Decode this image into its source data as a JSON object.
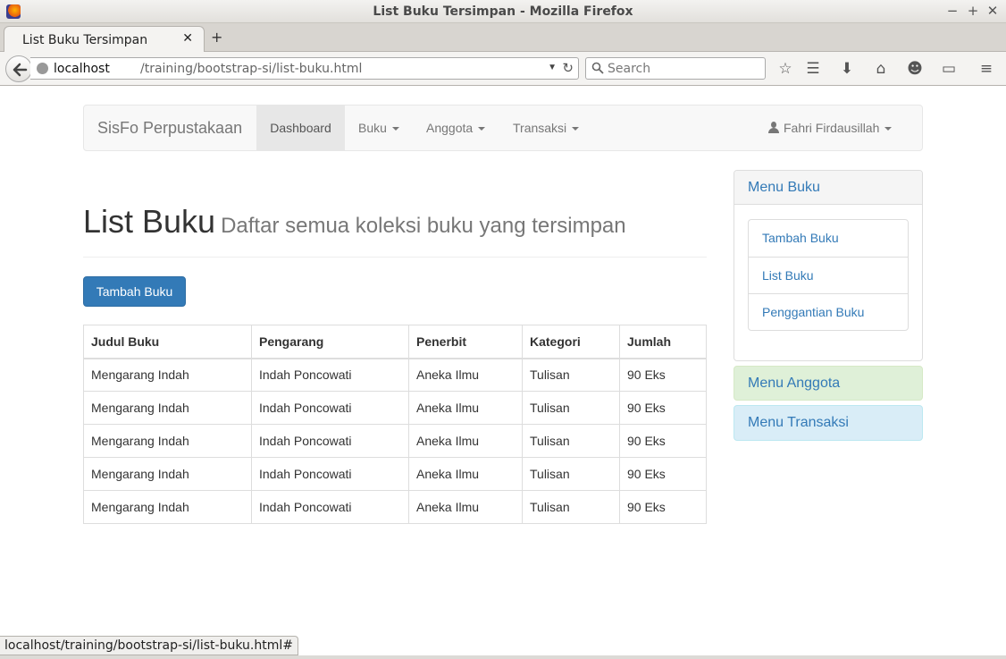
{
  "window": {
    "title": "List Buku Tersimpan - Mozilla Firefox",
    "tab_title": "List Buku Tersimpan",
    "url_host": "localhost",
    "url_path": "/training/bootstrap-si/list-buku.html",
    "search_placeholder": "Search",
    "status_url": "localhost/training/bootstrap-si/list-buku.html#"
  },
  "navbar": {
    "brand": "SisFo Perpustakaan",
    "items": [
      "Dashboard",
      "Buku",
      "Anggota",
      "Transaksi"
    ],
    "user": "Fahri Firdausillah"
  },
  "header": {
    "title": "List Buku",
    "subtitle": "Daftar semua koleksi buku yang tersimpan"
  },
  "add_button": "Tambah Buku",
  "table": {
    "columns": [
      "Judul Buku",
      "Pengarang",
      "Penerbit",
      "Kategori",
      "Jumlah"
    ],
    "rows": [
      [
        "Mengarang Indah",
        "Indah Poncowati",
        "Aneka Ilmu",
        "Tulisan",
        "90 Eks"
      ],
      [
        "Mengarang Indah",
        "Indah Poncowati",
        "Aneka Ilmu",
        "Tulisan",
        "90 Eks"
      ],
      [
        "Mengarang Indah",
        "Indah Poncowati",
        "Aneka Ilmu",
        "Tulisan",
        "90 Eks"
      ],
      [
        "Mengarang Indah",
        "Indah Poncowati",
        "Aneka Ilmu",
        "Tulisan",
        "90 Eks"
      ],
      [
        "Mengarang Indah",
        "Indah Poncowati",
        "Aneka Ilmu",
        "Tulisan",
        "90 Eks"
      ]
    ]
  },
  "sidebar": {
    "menu_buku": "Menu Buku",
    "buku_links": [
      "Tambah Buku",
      "List Buku",
      "Penggantian Buku"
    ],
    "menu_anggota": "Menu Anggota",
    "menu_transaksi": "Menu Transaksi"
  },
  "colors": {
    "primary": "#337ab7",
    "success_panel": "#dff0d8",
    "info_panel": "#d9edf7"
  }
}
